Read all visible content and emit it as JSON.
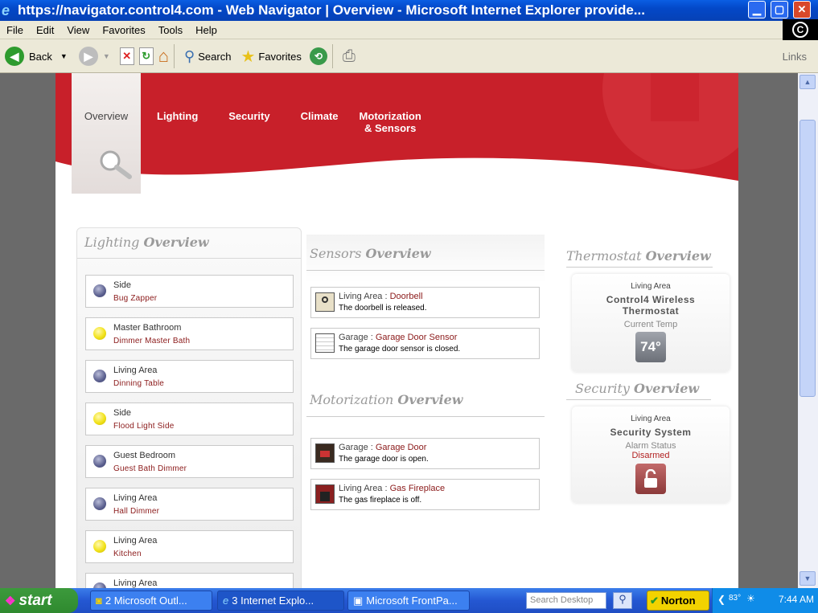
{
  "window": {
    "title": "https://navigator.control4.com - Web Navigator | Overview - Microsoft Internet Explorer provide..."
  },
  "menu": [
    "File",
    "Edit",
    "View",
    "Favorites",
    "Tools",
    "Help"
  ],
  "toolbar": {
    "back": "Back",
    "search": "Search",
    "favorites": "Favorites",
    "links": "Links"
  },
  "nav": {
    "overview": "Overview",
    "lighting": "Lighting",
    "security": "Security",
    "climate": "Climate",
    "motorization_line1": "Motorization",
    "motorization_line2": "& Sensors"
  },
  "lighting": {
    "title_a": "Lighting",
    "title_b": "Overview",
    "items": [
      {
        "room": "Side",
        "name": "Bug Zapper",
        "state": "off"
      },
      {
        "room": "Master Bathroom",
        "name": "Dimmer Master Bath",
        "state": "on"
      },
      {
        "room": "Living Area",
        "name": "Dinning Table",
        "state": "off"
      },
      {
        "room": "Side",
        "name": "Flood Light Side",
        "state": "on"
      },
      {
        "room": "Guest Bedroom",
        "name": "Guest Bath Dimmer",
        "state": "off"
      },
      {
        "room": "Living Area",
        "name": "Hall Dimmer",
        "state": "off"
      },
      {
        "room": "Living Area",
        "name": "Kitchen",
        "state": "on"
      },
      {
        "room": "Living Area",
        "name": "",
        "state": "off"
      }
    ]
  },
  "sensors": {
    "title_a": "Sensors",
    "title_b": "Overview",
    "items": [
      {
        "room": "Living Area : ",
        "device": "Doorbell",
        "status": "The doorbell is released.",
        "icon": "doorbell-icon"
      },
      {
        "room": "Garage : ",
        "device": "Garage Door Sensor",
        "status": "The garage door sensor is closed.",
        "icon": "garage-sensor-icon"
      }
    ]
  },
  "motorization": {
    "title_a": "Motorization",
    "title_b": "Overview",
    "items": [
      {
        "room": "Garage : ",
        "device": "Garage Door",
        "status": "The garage door is open.",
        "icon": "garage-door-icon"
      },
      {
        "room": "Living Area : ",
        "device": "Gas Fireplace",
        "status": "The gas fireplace is off.",
        "icon": "fireplace-icon"
      }
    ]
  },
  "thermostat": {
    "title_a": "Thermostat",
    "title_b": "Overview",
    "area": "Living Area",
    "device_line1": "Control4 Wireless",
    "device_line2": "Thermostat",
    "label": "Current Temp",
    "temp": "74°"
  },
  "security": {
    "title_a": "Security",
    "title_b": "Overview",
    "area": "Living Area",
    "device": "Security System",
    "label": "Alarm Status",
    "status": "Disarmed"
  },
  "taskbar": {
    "start": "start",
    "tasks": [
      "2 Microsoft Outl...",
      "3 Internet Explo...",
      "Microsoft FrontPa..."
    ],
    "search": "Search Desktop",
    "norton": "Norton",
    "temp": "83°",
    "clock": "7:44 AM"
  },
  "colors": {
    "brand_red": "#c8202a",
    "item_red": "#8b1a1a",
    "disarmed": "#b22222"
  }
}
